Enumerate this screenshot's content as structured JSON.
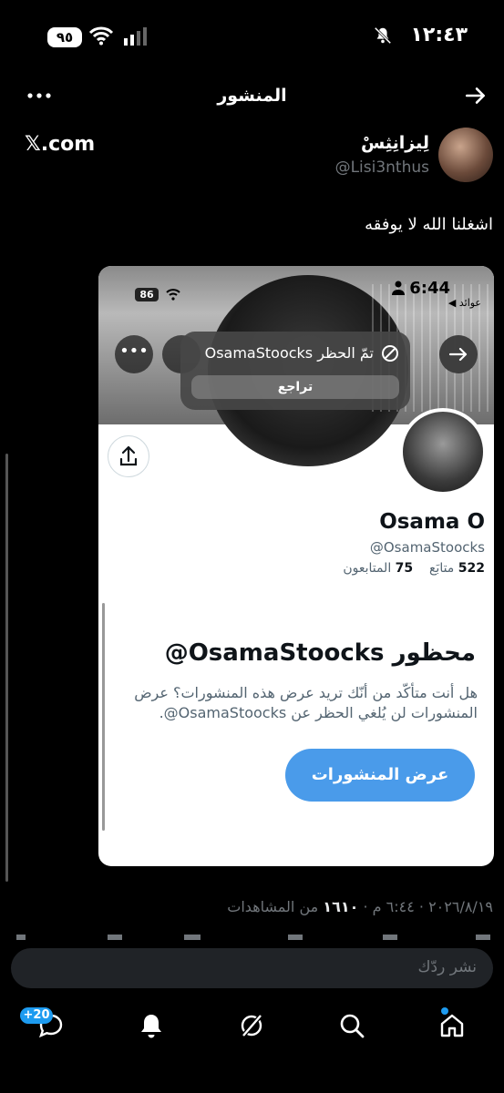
{
  "status_bar": {
    "time": "١٢:٤٣",
    "battery": "٩٥"
  },
  "header": {
    "title": "المنشور"
  },
  "post": {
    "author_name": "لِيزانِثِسْ",
    "author_handle": "@Lisi3nthus",
    "source_label": "𝕏.com",
    "text": "اشغلنا الله لا يوفقه",
    "meta_date": "٢٠٢٦/٨/١٩ · ٦:٤٤ م ·",
    "meta_views_count": "١٦١٠",
    "meta_views_label": "من المشاهدات"
  },
  "embedded": {
    "time": "6:44",
    "back_label": "◀ عوائد",
    "battery": "86",
    "toast_text": "تمّ الحظر OsamaStoocks",
    "toast_undo": "تراجع",
    "more_label": "•••",
    "profile_name": "Osama O",
    "profile_handle": "@OsamaStoocks",
    "following_count": "522",
    "following_label": "متابَع",
    "followers_count": "75",
    "followers_label": "المتابعون",
    "blocked_title": "محظور OsamaStoocks@",
    "blocked_desc": "هل أنت متأكّد من أنّك تريد عرض هذه المنشورات؟ عرض المنشورات لن يُلغي الحظر عن OsamaStoocks@.",
    "view_button": "عرض المنشورات"
  },
  "reply": {
    "placeholder": "نشر ردّك"
  },
  "nav": {
    "badge": "+20"
  },
  "colors": {
    "accent": "#1d9bf0",
    "view_button": "#4a9bea",
    "background": "#000000"
  }
}
